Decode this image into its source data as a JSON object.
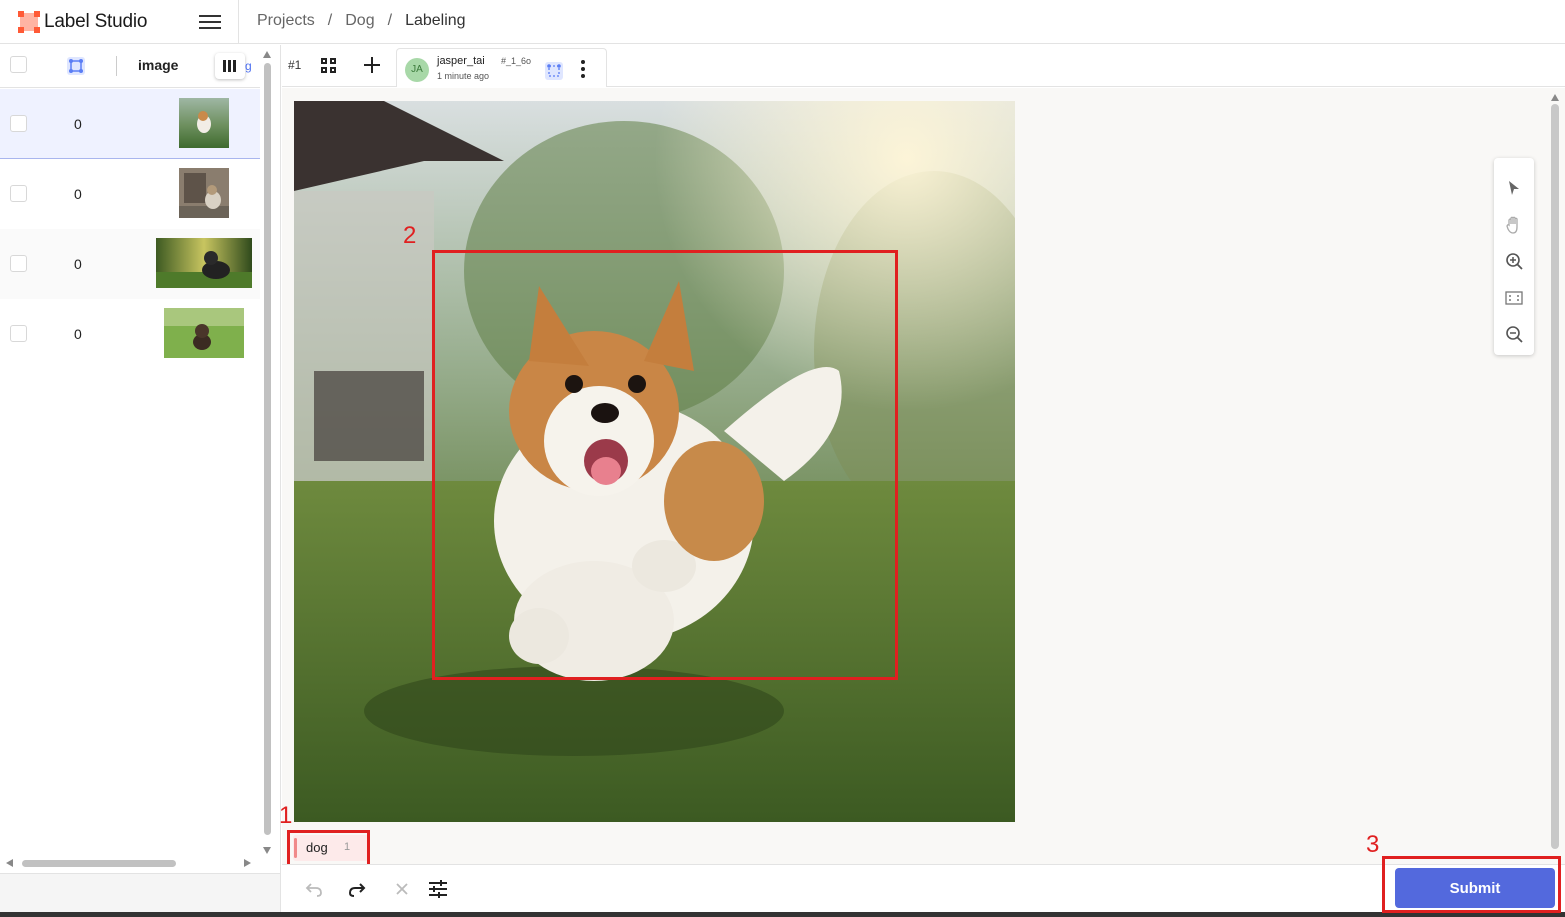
{
  "app": {
    "name": "Label Studio",
    "brand_color": "#ff7557",
    "accent_color": "#5369dd"
  },
  "breadcrumb": {
    "items": [
      "Projects",
      "Dog",
      "Labeling"
    ],
    "separator": "/"
  },
  "task_list": {
    "columns": {
      "image": "image",
      "overflow_text": "g"
    },
    "rows": [
      {
        "count": "0",
        "selected": true
      },
      {
        "count": "0",
        "selected": false
      },
      {
        "count": "0",
        "selected": false
      },
      {
        "count": "0",
        "selected": false
      }
    ]
  },
  "tabs": {
    "task_id": "#1",
    "annotation": {
      "avatar_initials": "JA",
      "user": "jasper_tai",
      "id": "#_1_6o",
      "time": "1 minute ago"
    }
  },
  "labels": [
    {
      "name": "dog",
      "count": "1",
      "color": "#f08a8a"
    }
  ],
  "annotation_markers": {
    "label": "1",
    "bbox": "2",
    "submit": "3"
  },
  "bottom_bar": {
    "submit_label": "Submit"
  },
  "icons": {
    "toolbar": [
      "pointer-icon",
      "hand-icon",
      "zoom-in-icon",
      "fit-icon",
      "zoom-out-icon"
    ],
    "bottom": [
      "undo-icon",
      "redo-icon",
      "reset-icon",
      "settings-icon"
    ]
  }
}
